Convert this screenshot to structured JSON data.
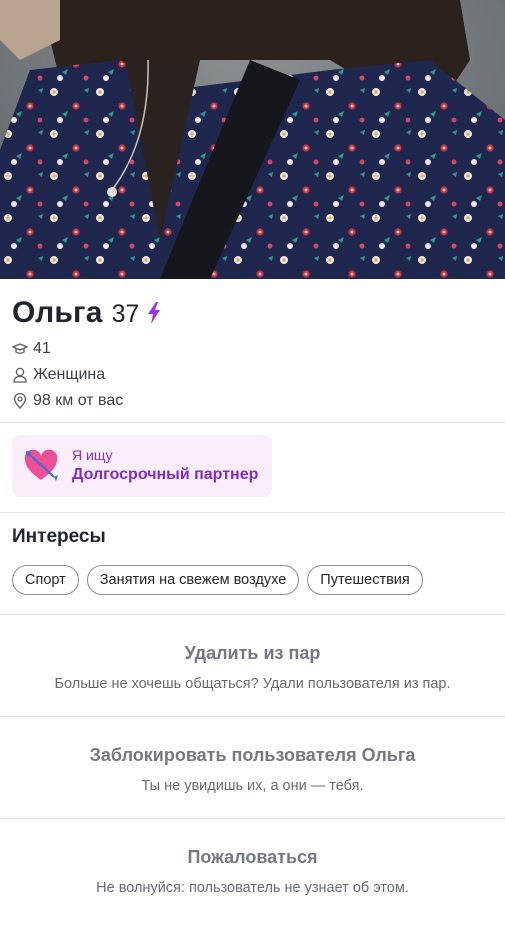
{
  "profile": {
    "name": "Ольга",
    "age": "37",
    "education_value": "41",
    "gender": "Женщина",
    "distance": "98 км от вас"
  },
  "icons": {
    "boost": "lightning-bolt-icon",
    "education": "graduation-cap-icon",
    "gender": "person-icon",
    "distance": "location-pin-icon",
    "looking_for": "heart-with-arrow-icon"
  },
  "looking_for": {
    "label": "Я ищу",
    "value": "Долгосрочный партнер"
  },
  "interests": {
    "title": "Интересы",
    "items": [
      "Спорт",
      "Занятия на свежем воздухе",
      "Путешествия"
    ]
  },
  "actions": {
    "unmatch_title": "Удалить из пар",
    "unmatch_subtitle": "Больше не хочешь общаться? Удали пользователя из пар.",
    "block_title": "Заблокировать пользователя Ольга",
    "block_subtitle": "Ты не увидишь их, а они — тебя.",
    "report_title": "Пожаловаться",
    "report_subtitle": "Не волнуйся: пользователь не узнает об этом."
  },
  "colors": {
    "accent_purple": "#7d2ad8",
    "looking_bg": "#fbeefb",
    "divider": "#dfe0e4",
    "action_text": "#737882"
  }
}
